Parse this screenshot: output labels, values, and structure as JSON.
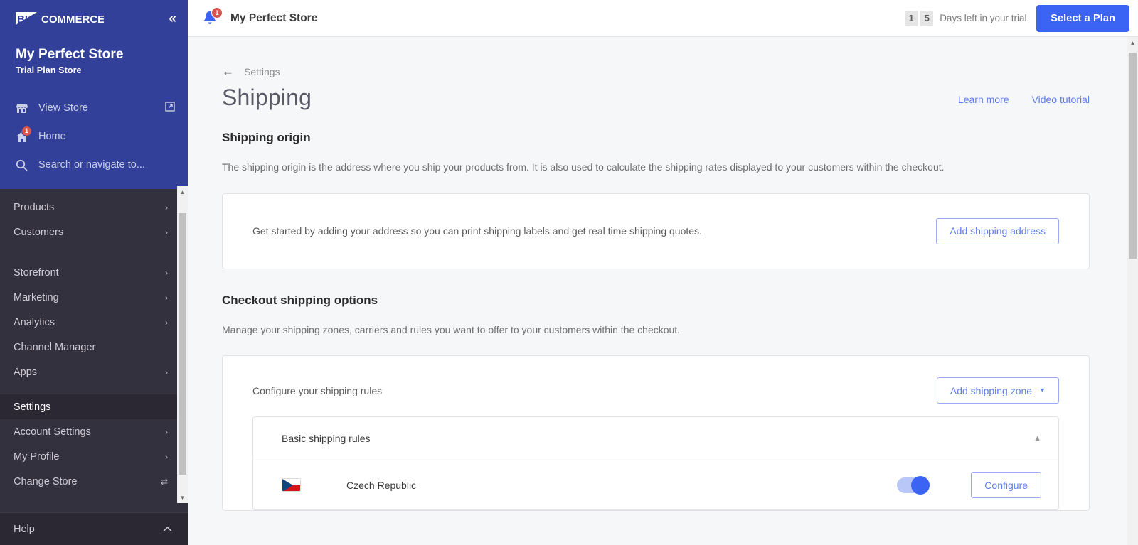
{
  "sidebar": {
    "logo_alt": "BIGCOMMERCE",
    "collapse_label": "«",
    "store_name": "My Perfect Store",
    "store_plan": "Trial Plan Store",
    "links": [
      {
        "label": "View Store",
        "icon": "store-icon",
        "trailing_icon": "external-link-icon",
        "badge": ""
      },
      {
        "label": "Home",
        "icon": "home-icon",
        "trailing_icon": "",
        "badge": "1"
      }
    ],
    "search_placeholder": "Search or navigate to...",
    "search_icon": "search-icon",
    "nav_groups": [
      {
        "items": [
          {
            "label": "Products",
            "chevron": "›",
            "active": false
          },
          {
            "label": "Customers",
            "chevron": "›",
            "active": false
          }
        ]
      },
      {
        "items": [
          {
            "label": "Storefront",
            "chevron": "›",
            "active": false
          },
          {
            "label": "Marketing",
            "chevron": "›",
            "active": false
          },
          {
            "label": "Analytics",
            "chevron": "›",
            "active": false
          },
          {
            "label": "Channel Manager",
            "chevron": "",
            "active": false
          },
          {
            "label": "Apps",
            "chevron": "›",
            "active": false
          }
        ]
      },
      {
        "items": [
          {
            "label": "Settings",
            "chevron": "",
            "active": true
          },
          {
            "label": "Account Settings",
            "chevron": "›",
            "active": false
          },
          {
            "label": "My Profile",
            "chevron": "›",
            "active": false
          },
          {
            "label": "Change Store",
            "chevron": "⇄",
            "active": false
          }
        ]
      }
    ],
    "help_label": "Help",
    "help_chevron": "⌃"
  },
  "topbar": {
    "notification_icon": "bell-icon",
    "notification_count": "1",
    "title": "My Perfect Store",
    "trial_digits": [
      "1",
      "5"
    ],
    "trial_text": "Days left in your trial.",
    "plan_button": "Select a Plan"
  },
  "page": {
    "breadcrumb": "Settings",
    "back_icon": "arrow-left-icon",
    "title": "Shipping",
    "head_links": [
      {
        "label": "Learn more"
      },
      {
        "label": "Video tutorial"
      }
    ],
    "origin": {
      "heading": "Shipping origin",
      "description": "The shipping origin is the address where you ship your products from. It is also used to calculate the shipping rates displayed to your customers within the checkout.",
      "card_text": "Get started by adding your address so you can print shipping labels and get real time shipping quotes.",
      "card_button": "Add shipping address"
    },
    "checkout": {
      "heading": "Checkout shipping options",
      "description": "Manage your shipping zones, carriers and rules you want to offer to your customers within the checkout.",
      "rules_label": "Configure your shipping rules",
      "add_zone_button": "Add shipping zone",
      "add_zone_caret": "▼",
      "group_title": "Basic shipping rules",
      "group_chevron": "▲",
      "zones": [
        {
          "flag": "czech-republic-flag",
          "name": "Czech Republic",
          "enabled": true,
          "configure_label": "Configure"
        }
      ]
    }
  },
  "colors": {
    "brand_blue": "#32409a",
    "accent_blue": "#3c64f4",
    "link_blue": "#5f7dee",
    "nav_dark": "#34313f",
    "badge_red": "#d9534f"
  }
}
